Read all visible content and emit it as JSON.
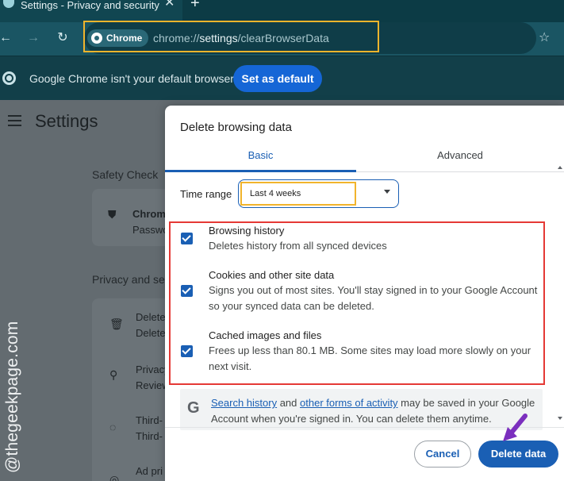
{
  "browser": {
    "tab_title": "Settings - Privacy and security",
    "tab_close": "✕",
    "new_tab": "+",
    "back": "←",
    "forward": "→",
    "reload": "↻",
    "chip_label": "Chrome",
    "url_prefix": "chrome://",
    "url_host": "settings",
    "url_path": "/clearBrowserData",
    "bookmark_icon": "☆"
  },
  "infobar": {
    "text": "Google Chrome isn't your default browser",
    "button": "Set as default"
  },
  "settings": {
    "title": "Settings",
    "safety_check": "Safety Check",
    "safety_item_title": "Chrom",
    "safety_item_sub": "Passwo",
    "privacy_label": "Privacy and se",
    "items": [
      {
        "line1": "Delete",
        "line2": "Delete",
        "icon": "🗑"
      },
      {
        "line1": "Privacy",
        "line2": "Review",
        "icon": "⚲"
      },
      {
        "line1": "Third-",
        "line2": "Third-",
        "icon": "◌"
      },
      {
        "line1": "Ad pri",
        "line2": "",
        "icon": "◎"
      }
    ]
  },
  "watermark": "@thegeekpage.com",
  "dialog": {
    "title": "Delete browsing data",
    "tabs": [
      "Basic",
      "Advanced"
    ],
    "time_range_label": "Time range",
    "time_range_value": "Last 4 weeks",
    "options": [
      {
        "title": "Browsing history",
        "desc": "Deletes history from all synced devices",
        "checked": true
      },
      {
        "title": "Cookies and other site data",
        "desc": "Signs you out of most sites. You'll stay signed in to your Google Account so your synced data can be deleted.",
        "checked": true
      },
      {
        "title": "Cached images and files",
        "desc": "Frees up less than 80.1 MB. Some sites may load more slowly on your next visit.",
        "checked": true
      }
    ],
    "notice": {
      "link1": "Search history",
      "mid": " and ",
      "link2": "other forms of activity",
      "rest": " may be saved in your Google Account when you're signed in. You can delete them anytime."
    },
    "cancel": "Cancel",
    "delete": "Delete data"
  },
  "colors": {
    "accent": "#1a5fb4",
    "highlight_yellow": "#f1b42c",
    "highlight_red": "#e53935",
    "arrow_purple": "#7b2fbe"
  }
}
